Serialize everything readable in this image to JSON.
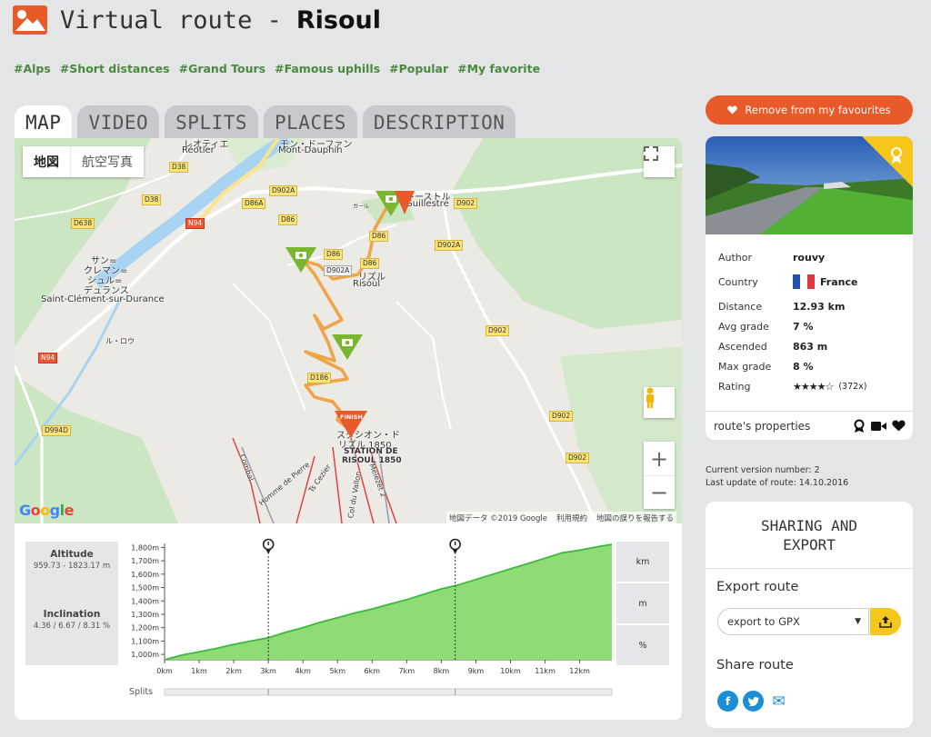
{
  "header": {
    "prefix": "Virtual route -",
    "route_name": "Risoul",
    "logo": "mountain-logo-icon"
  },
  "tags": [
    "#Alps",
    "#Short distances",
    "#Grand Tours",
    "#Famous uphills",
    "#Popular",
    "#My favorite"
  ],
  "tabs": [
    {
      "label": "MAP",
      "active": true
    },
    {
      "label": "VIDEO",
      "active": false
    },
    {
      "label": "SPLITS",
      "active": false
    },
    {
      "label": "PLACES",
      "active": false
    },
    {
      "label": "DESCRIPTION",
      "active": false
    }
  ],
  "map": {
    "type_map": "地図",
    "type_satellite": "航空写真",
    "labels": {
      "reotier": "Réotier",
      "reotier_jp": "レオティエ",
      "mont_dauphin": "Mont-Dauphin",
      "mont_dauphin_jp": "モン・ドーファン",
      "guillestre": "Guillestre",
      "guillestre_jp": "ギーストル",
      "risoul": "Risoul",
      "risoul_jp": "リズル",
      "saint_clement": "Saint-Clément-sur-Durance",
      "saint_clement_jp1": "サン=",
      "saint_clement_jp2": "クレマン=",
      "saint_clement_jp3": "シュル=",
      "saint_clement_jp4": "デュランス",
      "station_jp1": "スタシオン・ド",
      "station_jp2": "リズル 1850",
      "station1": "STATION DE",
      "station2": "RISOUL 1850",
      "finish": "FINISH",
      "combal": "Combal",
      "homme_pierre": "Homme de Pierre",
      "cezier": "Ts Cezier",
      "col_vallon": "Col du Vallon",
      "melezet": "Mélézet 1",
      "melezet2": "Melezet 2",
      "ru_jp": "ル・ロウ",
      "gare": "ガール"
    },
    "roads": [
      "D38",
      "D38",
      "D638",
      "N94",
      "N94",
      "D902A",
      "D86A",
      "D86",
      "D902",
      "D902A",
      "D86",
      "D86",
      "D86",
      "D902",
      "D186",
      "D902",
      "D902",
      "D994D",
      "D902A"
    ],
    "attribution": "地図データ ©2019 Google",
    "terms": "利用規約",
    "report": "地図の誤りを報告する",
    "google": "Google"
  },
  "profile": {
    "altitude_label": "Altitude",
    "altitude_value": "959.73 - 1823.17 m",
    "inclination_label": "Inclination",
    "inclination_value": "4.36 / 6.67 / 8.31 %",
    "units": [
      "km",
      "m",
      "%"
    ],
    "splits_label": "Splits",
    "y_ticks": [
      "1,800m",
      "1,700m",
      "1,600m",
      "1,500m",
      "1,400m",
      "1,300m",
      "1,200m",
      "1,100m",
      "1,000m"
    ],
    "x_ticks": [
      "0km",
      "1km",
      "2km",
      "3km",
      "4km",
      "5km",
      "6km",
      "7km",
      "8km",
      "9km",
      "10km",
      "11km",
      "12km"
    ],
    "split_markers_km": [
      3.0,
      8.4
    ]
  },
  "chart_data": {
    "type": "area",
    "xlabel": "",
    "ylabel": "",
    "x_unit": "km",
    "y_unit": "m",
    "xlim": [
      0,
      12.93
    ],
    "ylim": [
      960,
      1830
    ],
    "x": [
      0,
      0.5,
      1,
      1.5,
      2,
      2.5,
      3,
      3.5,
      4,
      4.5,
      5,
      5.5,
      6,
      6.5,
      7,
      7.5,
      8,
      8.5,
      9,
      9.5,
      10,
      10.5,
      11,
      11.5,
      12,
      12.5,
      12.93
    ],
    "series": [
      {
        "values": [
          960,
          995,
          1020,
          1045,
          1075,
          1100,
          1125,
          1165,
          1200,
          1240,
          1275,
          1310,
          1340,
          1375,
          1410,
          1450,
          1490,
          1520,
          1560,
          1600,
          1640,
          1680,
          1720,
          1760,
          1780,
          1805,
          1823
        ]
      }
    ]
  },
  "favourite_button": "Remove from my favourites",
  "route_card": {
    "rows": [
      {
        "key": "Author",
        "value": "rouvy"
      },
      {
        "key": "Country",
        "value": "France"
      },
      {
        "key": "Distance",
        "value": "12.93 km"
      },
      {
        "key": "Avg grade",
        "value": "7 %"
      },
      {
        "key": "Ascended",
        "value": "863 m"
      },
      {
        "key": "Max grade",
        "value": "8 %"
      },
      {
        "key": "Rating",
        "value": "★★★★☆"
      }
    ],
    "rating_count": "(372x)",
    "rating_stars": 4,
    "properties_label": "route's properties"
  },
  "version": {
    "current": "Current version number: 2",
    "updated": "Last update of route: 14.10.2016"
  },
  "share": {
    "title": "SHARING AND EXPORT",
    "export_label": "Export route",
    "export_select": "export to GPX",
    "share_label": "Share route",
    "social": [
      "f",
      "t",
      "✉"
    ]
  },
  "colors": {
    "accent": "#e85a2a",
    "tag": "#4a8a3e",
    "route": "#f0a448",
    "area": "#8fdc77",
    "export": "#f6c61a",
    "social": "#1a8ed6"
  }
}
